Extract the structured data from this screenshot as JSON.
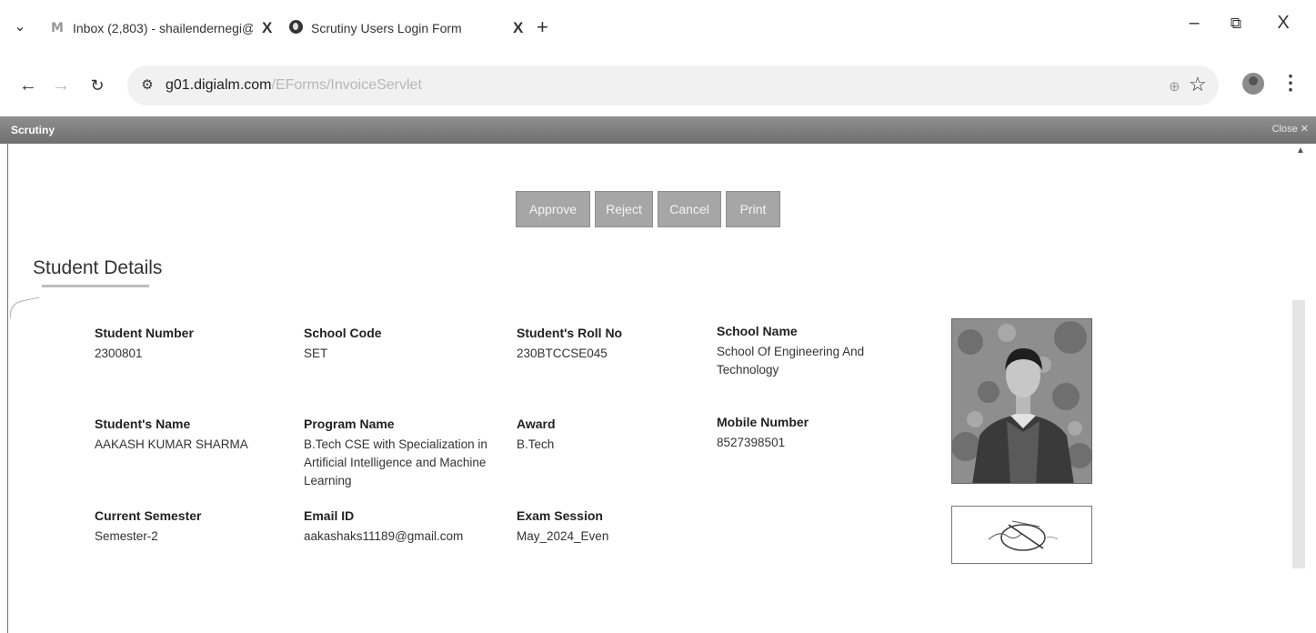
{
  "browser": {
    "tabs": [
      {
        "label": "Inbox (2,803) - shailendernegi@",
        "close": "X"
      },
      {
        "label": "Scrutiny Users Login Form",
        "close": "X"
      }
    ],
    "new_tab": "+",
    "window_controls": {
      "minimize": "–",
      "restore": "⧉",
      "close": "X"
    },
    "url_host": "g01.digialm.com",
    "url_path": "/EForms/InvoiceServlet",
    "icons": [
      "tab-menu-icon",
      "gmail-icon",
      "globe-icon",
      "back-icon",
      "forward-icon",
      "reload-icon",
      "site-settings-icon",
      "zoom-icon",
      "bookmark-star-icon",
      "profile-avatar",
      "menu-kebab-icon"
    ]
  },
  "window": {
    "title": "Scrutiny",
    "close_label": "Close ✕"
  },
  "actions": {
    "approve": "Approve",
    "reject": "Reject",
    "cancel": "Cancel",
    "print": "Print"
  },
  "section": {
    "title": "Student Details"
  },
  "student": {
    "student_number": {
      "label": "Student Number",
      "value": "2300801"
    },
    "school_code": {
      "label": "School Code",
      "value": "SET"
    },
    "roll_no": {
      "label": "Student's Roll No",
      "value": "230BTCCSE045"
    },
    "school_name": {
      "label": "School Name",
      "value": "School Of Engineering And Technology"
    },
    "name": {
      "label": "Student's Name",
      "value": "AAKASH KUMAR SHARMA"
    },
    "program": {
      "label": "Program Name",
      "value": "B.Tech CSE with Specialization in Artificial Intelligence and Machine Learning"
    },
    "award": {
      "label": "Award",
      "value": "B.Tech"
    },
    "mobile": {
      "label": "Mobile Number",
      "value": "8527398501"
    },
    "semester": {
      "label": "Current Semester",
      "value": "Semester-2"
    },
    "email": {
      "label": "Email ID",
      "value": "aakashaks11189@gmail.com"
    },
    "exam_session": {
      "label": "Exam Session",
      "value": "May_2024_Even"
    }
  },
  "colors": {
    "button_bg": "#a6a6a6",
    "window_bar": "#7a7a7a",
    "omnibox": "#f1f1f1"
  }
}
